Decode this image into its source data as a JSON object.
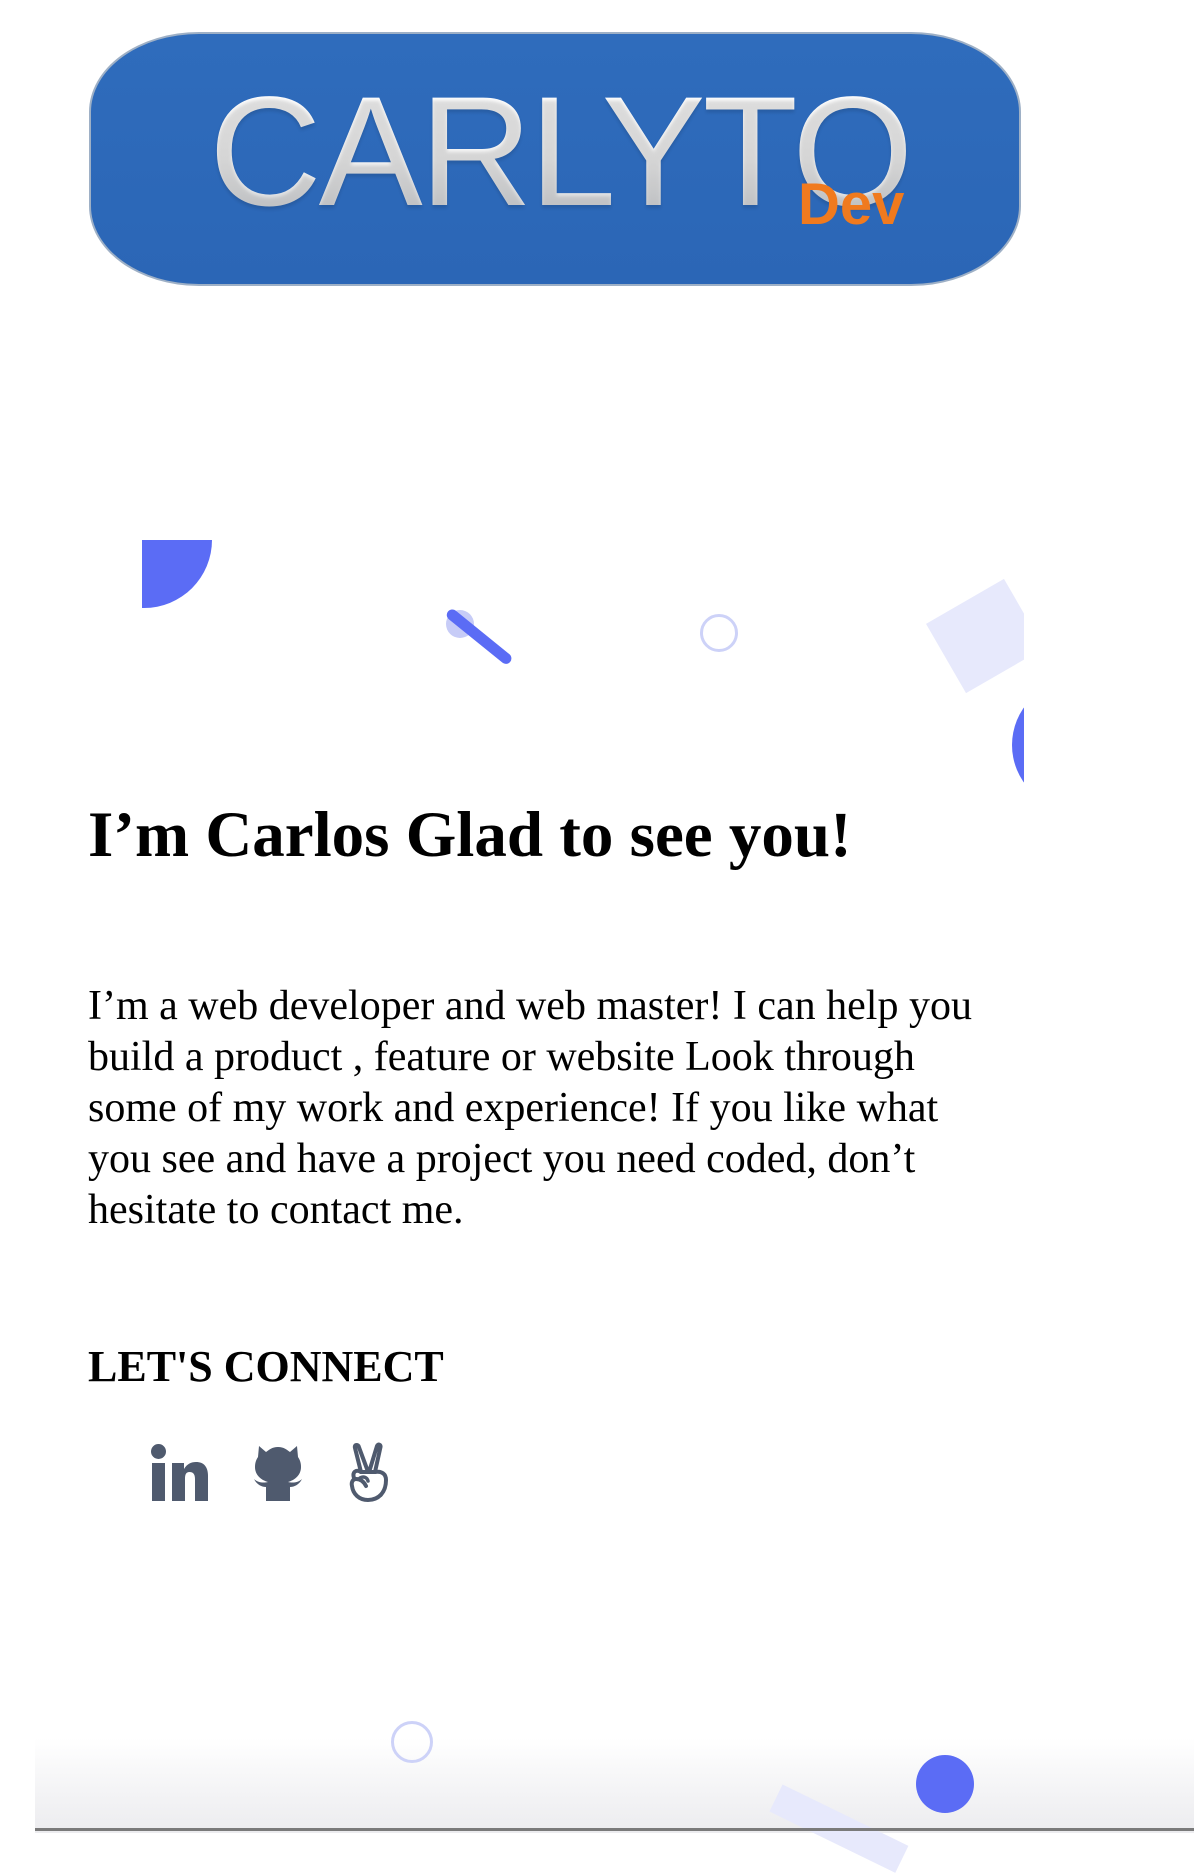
{
  "logo": {
    "name": "CARLYTO",
    "suffix": "Dev",
    "colors": {
      "background": "#2e6bbb",
      "suffix": "#f07a1e",
      "text": "#f4f4f4"
    }
  },
  "hero": {
    "headline": "I’m Carlos Glad to see you!",
    "bio": "I’m a web developer and web master! I can help you build a product , feature or website Look through some of my work and experience! If you like what you see and have a project you need coded, don’t hesitate to contact me."
  },
  "connect": {
    "heading": "LET'S CONNECT",
    "links": [
      {
        "icon": "linkedin-icon"
      },
      {
        "icon": "github-icon"
      },
      {
        "icon": "angellist-icon"
      }
    ]
  },
  "theme": {
    "accent": "#5b6cf5",
    "accent_light": "#e7e9fc",
    "icon_color": "#4f5a6e"
  }
}
